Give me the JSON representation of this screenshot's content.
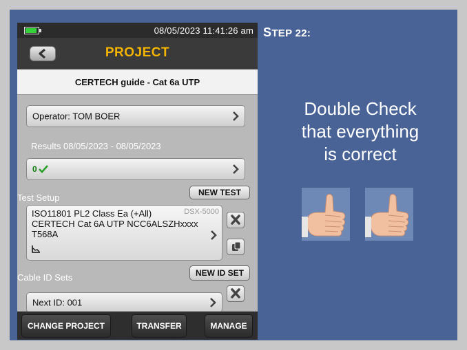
{
  "status_bar": {
    "datetime": "08/05/2023 11:41:26 am",
    "battery_icon": "battery-icon"
  },
  "header": {
    "title": "PROJECT",
    "back_icon": "back-arrow-icon"
  },
  "project_name": "CERTECH guide - Cat 6a UTP",
  "operator_button": "Operator: TOM BOER",
  "results_range": "Results 08/05/2023 - 08/05/2023",
  "result_count": "0",
  "test_setup": {
    "label": "Test Setup",
    "new_test_label": "NEW TEST",
    "line1": "ISO11801 PL2 Class Ea (+All)",
    "line2": "CERTECH Cat 6A UTP NCC6ALSZHxxxx",
    "line3": "T568A",
    "tester_model": "DSX-5000"
  },
  "cable_id": {
    "label": "Cable ID Sets",
    "new_id_set_label": "NEW ID SET",
    "next_id": "Next ID: 001"
  },
  "bottom_bar": {
    "change_project": "CHANGE PROJECT",
    "transfer": "TRANSFER",
    "manage": "MANAGE"
  },
  "step": {
    "initial": "S",
    "rest": "TEP 22:"
  },
  "instruction": {
    "line1": "Double Check",
    "line2": "that everything",
    "line3": "is correct"
  },
  "colors": {
    "slide_bg": "#4a6396",
    "title_accent": "#f4b400",
    "check_green": "#2aa02a"
  }
}
